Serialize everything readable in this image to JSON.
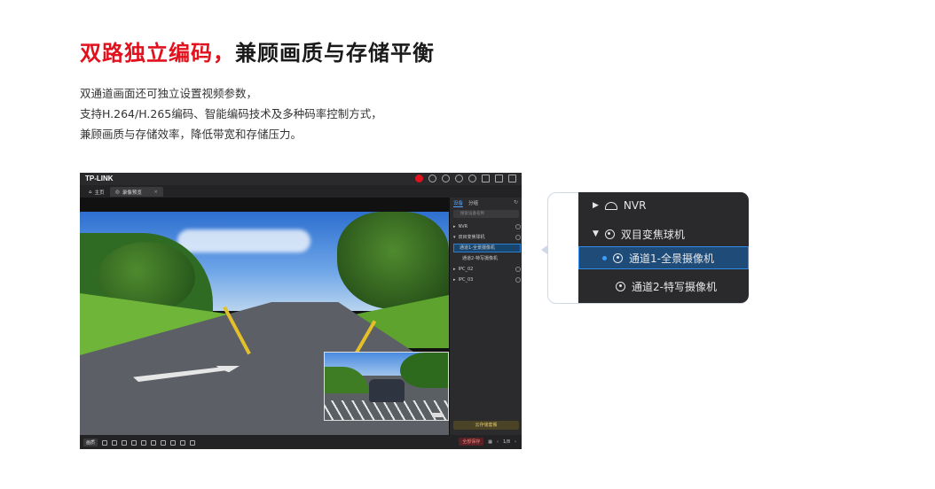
{
  "headline": {
    "red_part": "双路独立编码，",
    "black_part": "兼顾画质与存储平衡"
  },
  "description": [
    "双通道画面还可独立设置视频参数，",
    "支持H.264/H.265编码、智能编码技术及多种码率控制方式，",
    "兼顾画质与存储效率，降低带宽和存储压力。"
  ],
  "app": {
    "logo": "TP-LINK",
    "tabs": {
      "home": "主页",
      "preview": "录像预览"
    },
    "panel": {
      "tabs": [
        "设备",
        "分组"
      ],
      "search_placeholder": "搜索设备名称",
      "tree": [
        "NVR",
        "双目变焦球机",
        "通道1-全景摄像机",
        "通道2-特写摄像机",
        "IPC_02",
        "IPC_03"
      ],
      "gold_button": "云存储套餐"
    },
    "bottombar": {
      "left_label": "画质",
      "red_button": "全部保存",
      "page": "1/8"
    }
  },
  "callout": {
    "items": [
      "NVR",
      "双目变焦球机",
      "通道1-全景摄像机",
      "通道2-特写摄像机"
    ]
  }
}
